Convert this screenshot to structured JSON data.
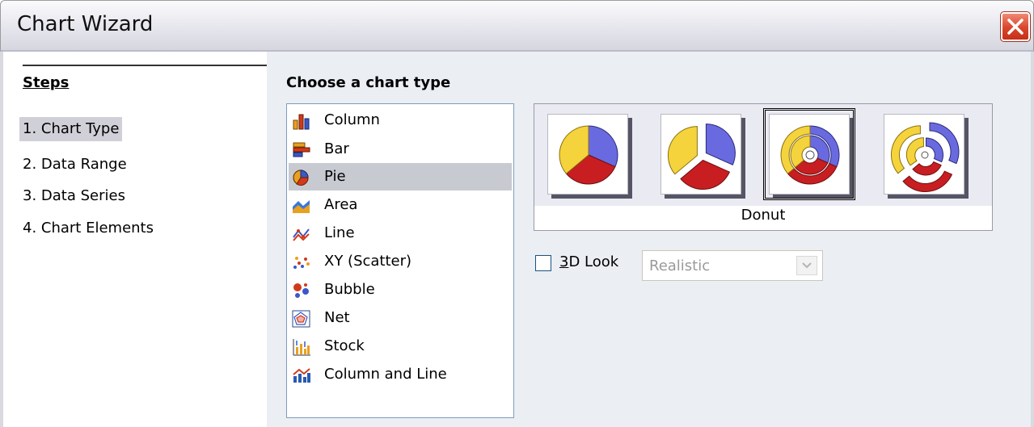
{
  "window": {
    "title": "Chart Wizard"
  },
  "steps": {
    "heading": "Steps",
    "items": [
      {
        "label": "1. Chart Type",
        "active": true
      },
      {
        "label": "2. Data Range",
        "active": false
      },
      {
        "label": "3. Data Series",
        "active": false
      },
      {
        "label": "4. Chart Elements",
        "active": false
      }
    ]
  },
  "main": {
    "heading": "Choose a chart type",
    "chart_types": [
      {
        "label": "Column",
        "icon": "column-chart-icon",
        "selected": false
      },
      {
        "label": "Bar",
        "icon": "bar-chart-icon",
        "selected": false
      },
      {
        "label": "Pie",
        "icon": "pie-chart-icon",
        "selected": true
      },
      {
        "label": "Area",
        "icon": "area-chart-icon",
        "selected": false
      },
      {
        "label": "Line",
        "icon": "line-chart-icon",
        "selected": false
      },
      {
        "label": "XY (Scatter)",
        "icon": "scatter-chart-icon",
        "selected": false
      },
      {
        "label": "Bubble",
        "icon": "bubble-chart-icon",
        "selected": false
      },
      {
        "label": "Net",
        "icon": "net-chart-icon",
        "selected": false
      },
      {
        "label": "Stock",
        "icon": "stock-chart-icon",
        "selected": false
      },
      {
        "label": "Column and Line",
        "icon": "column-and-line-chart-icon",
        "selected": false
      }
    ],
    "variants": {
      "items": [
        "normal-pie",
        "exploded-pie",
        "donut",
        "exploded-donut"
      ],
      "selected_index": 2,
      "caption": "Donut"
    },
    "look_3d": {
      "label_accel": "3",
      "label_rest": "D Look",
      "checked": false
    },
    "look_select": {
      "value": "Realistic",
      "enabled": false
    }
  },
  "colors": {
    "yellow": "#f5d33c",
    "blue": "#6a6ae0",
    "red": "#c81e22"
  }
}
